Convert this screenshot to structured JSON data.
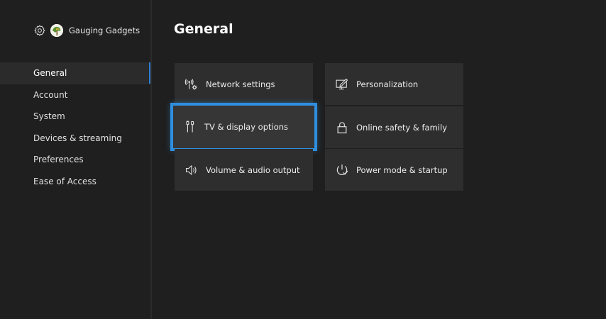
{
  "profile": {
    "gamertag": "Gauging Gadgets",
    "settings_icon": "gear-icon",
    "avatar_icon": "avatar-image"
  },
  "sidebar": {
    "items": [
      {
        "label": "General",
        "selected": true
      },
      {
        "label": "Account",
        "selected": false
      },
      {
        "label": "System",
        "selected": false
      },
      {
        "label": "Devices & streaming",
        "selected": false
      },
      {
        "label": "Preferences",
        "selected": false
      },
      {
        "label": "Ease of Access",
        "selected": false
      }
    ]
  },
  "main": {
    "title": "General",
    "tiles": [
      {
        "label": "Network settings",
        "icon": "network-icon",
        "focused": false
      },
      {
        "label": "Personalization",
        "icon": "personalization-icon",
        "focused": false
      },
      {
        "label": "TV & display options",
        "icon": "tv-display-icon",
        "focused": true
      },
      {
        "label": "Online safety & family",
        "icon": "lock-icon",
        "focused": false
      },
      {
        "label": "Volume & audio output",
        "icon": "speaker-icon",
        "focused": false
      },
      {
        "label": "Power mode & startup",
        "icon": "power-icon",
        "focused": false
      }
    ]
  },
  "colors": {
    "background": "#1f1f1f",
    "tile": "#2e2e2e",
    "focus_accent": "#2f8fde",
    "selection_bar": "#2e7fd0"
  }
}
